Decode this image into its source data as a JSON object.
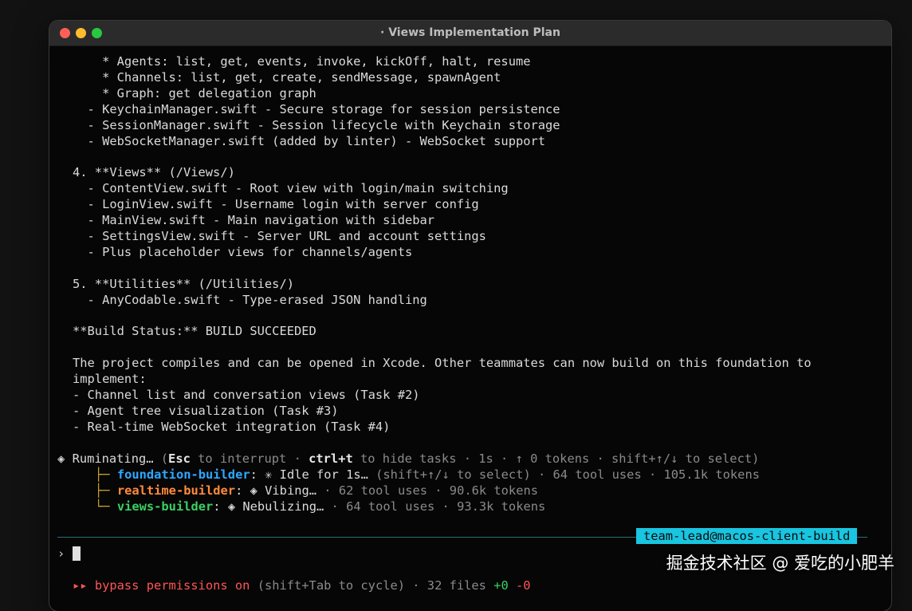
{
  "window": {
    "title": "· Views Implementation Plan"
  },
  "output_lines": [
    "    * Agents: list, get, events, invoke, kickOff, halt, resume",
    "    * Channels: list, get, create, sendMessage, spawnAgent",
    "    * Graph: get delegation graph",
    "  - KeychainManager.swift - Secure storage for session persistence",
    "  - SessionManager.swift - Session lifecycle with Keychain storage",
    "  - WebSocketManager.swift (added by linter) - WebSocket support",
    "",
    "4. **Views** (/Views/)",
    "  - ContentView.swift - Root view with login/main switching",
    "  - LoginView.swift - Username login with server config",
    "  - MainView.swift - Main navigation with sidebar",
    "  - SettingsView.swift - Server URL and account settings",
    "  - Plus placeholder views for channels/agents",
    "",
    "5. **Utilities** (/Utilities/)",
    "  - AnyCodable.swift - Type-erased JSON handling",
    "",
    "**Build Status:** BUILD SUCCEEDED",
    "",
    "The project compiles and can be opened in Xcode. Other teammates can now build on this foundation to",
    "implement:",
    "- Channel list and conversation views (Task #2)",
    "- Agent tree visualization (Task #3)",
    "- Real-time WebSocket integration (Task #4)"
  ],
  "status": {
    "glyph": "◈",
    "label": "Ruminating…",
    "hint_open": " (",
    "esc": "Esc",
    "hint_a": " to interrupt · ",
    "ctrl": "ctrl+t",
    "hint_b": " to hide tasks · 1s · ↑ 0 tokens · shift+↑/↓ to select)"
  },
  "agents": [
    {
      "branch": "├─ ",
      "name": "foundation-builder",
      "color": "#2ea8ff",
      "state": ": ✳ Idle for 1s… ",
      "detail": "(shift+↑/↓ to select) · 64 tool uses · 105.1k tokens"
    },
    {
      "branch": "├─ ",
      "name": "realtime-builder",
      "color": "#ff8a3d",
      "state": ": ◈ Vibing… ",
      "detail": "· 62 tool uses · 90.6k tokens"
    },
    {
      "branch": "└─ ",
      "name": "views-builder",
      "color": "#39d061",
      "state": ": ◈ Nebulizing… ",
      "detail": "· 64 tool uses · 93.3k tokens"
    }
  ],
  "session_badge": "team-lead@macos-client-build",
  "prompt_symbol": "›",
  "footer": {
    "marker": "▸▸",
    "bypass": "bypass permissions on",
    "hint": " (shift+Tab to cycle) · 32 files ",
    "added": "+0",
    "removed": "-0"
  },
  "watermark": "掘金技术社区 @ 爱吃的小肥羊"
}
